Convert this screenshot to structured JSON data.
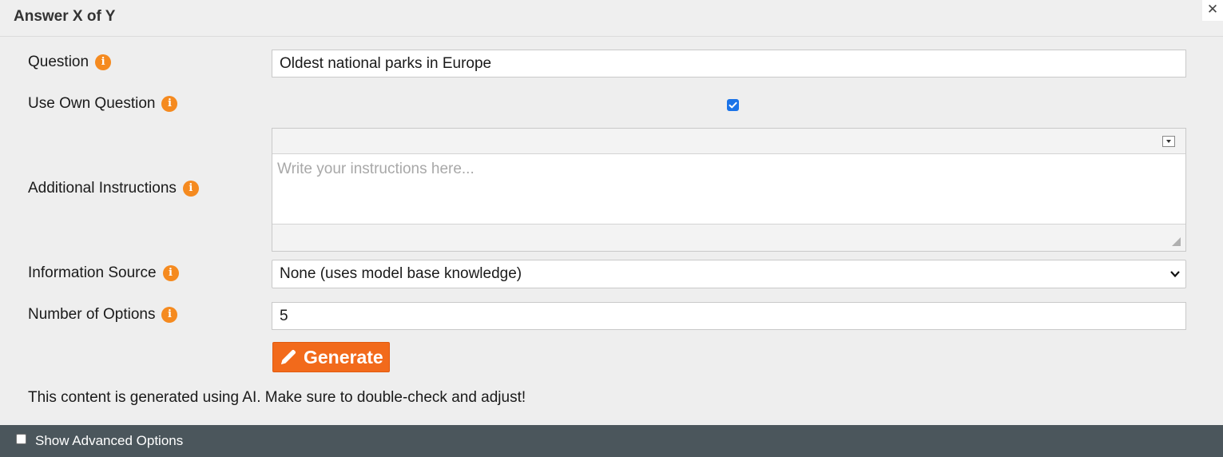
{
  "dialog": {
    "title": "Answer X of Y",
    "close_label": "✕"
  },
  "form": {
    "info_glyph": "i",
    "question": {
      "label": "Question",
      "value": "Oldest national parks in Europe"
    },
    "use_own_question": {
      "label": "Use Own Question",
      "checked": true
    },
    "additional_instructions": {
      "label": "Additional Instructions",
      "placeholder": "Write your instructions here...",
      "value": ""
    },
    "information_source": {
      "label": "Information Source",
      "selected": "None (uses model base knowledge)"
    },
    "number_of_options": {
      "label": "Number of Options",
      "value": "5"
    },
    "generate_button": {
      "label": "Generate",
      "icon": "pencil-icon"
    },
    "notice": "This content is generated using AI. Make sure to double-check and adjust!"
  },
  "footer": {
    "advanced_label": "Show Advanced Options",
    "advanced_checked": false
  },
  "colors": {
    "accent": "#f26a1b",
    "info_icon": "#f58a1f",
    "checkbox": "#1a73e8",
    "footer_bar": "#4b565c",
    "background": "#eeeeee"
  }
}
